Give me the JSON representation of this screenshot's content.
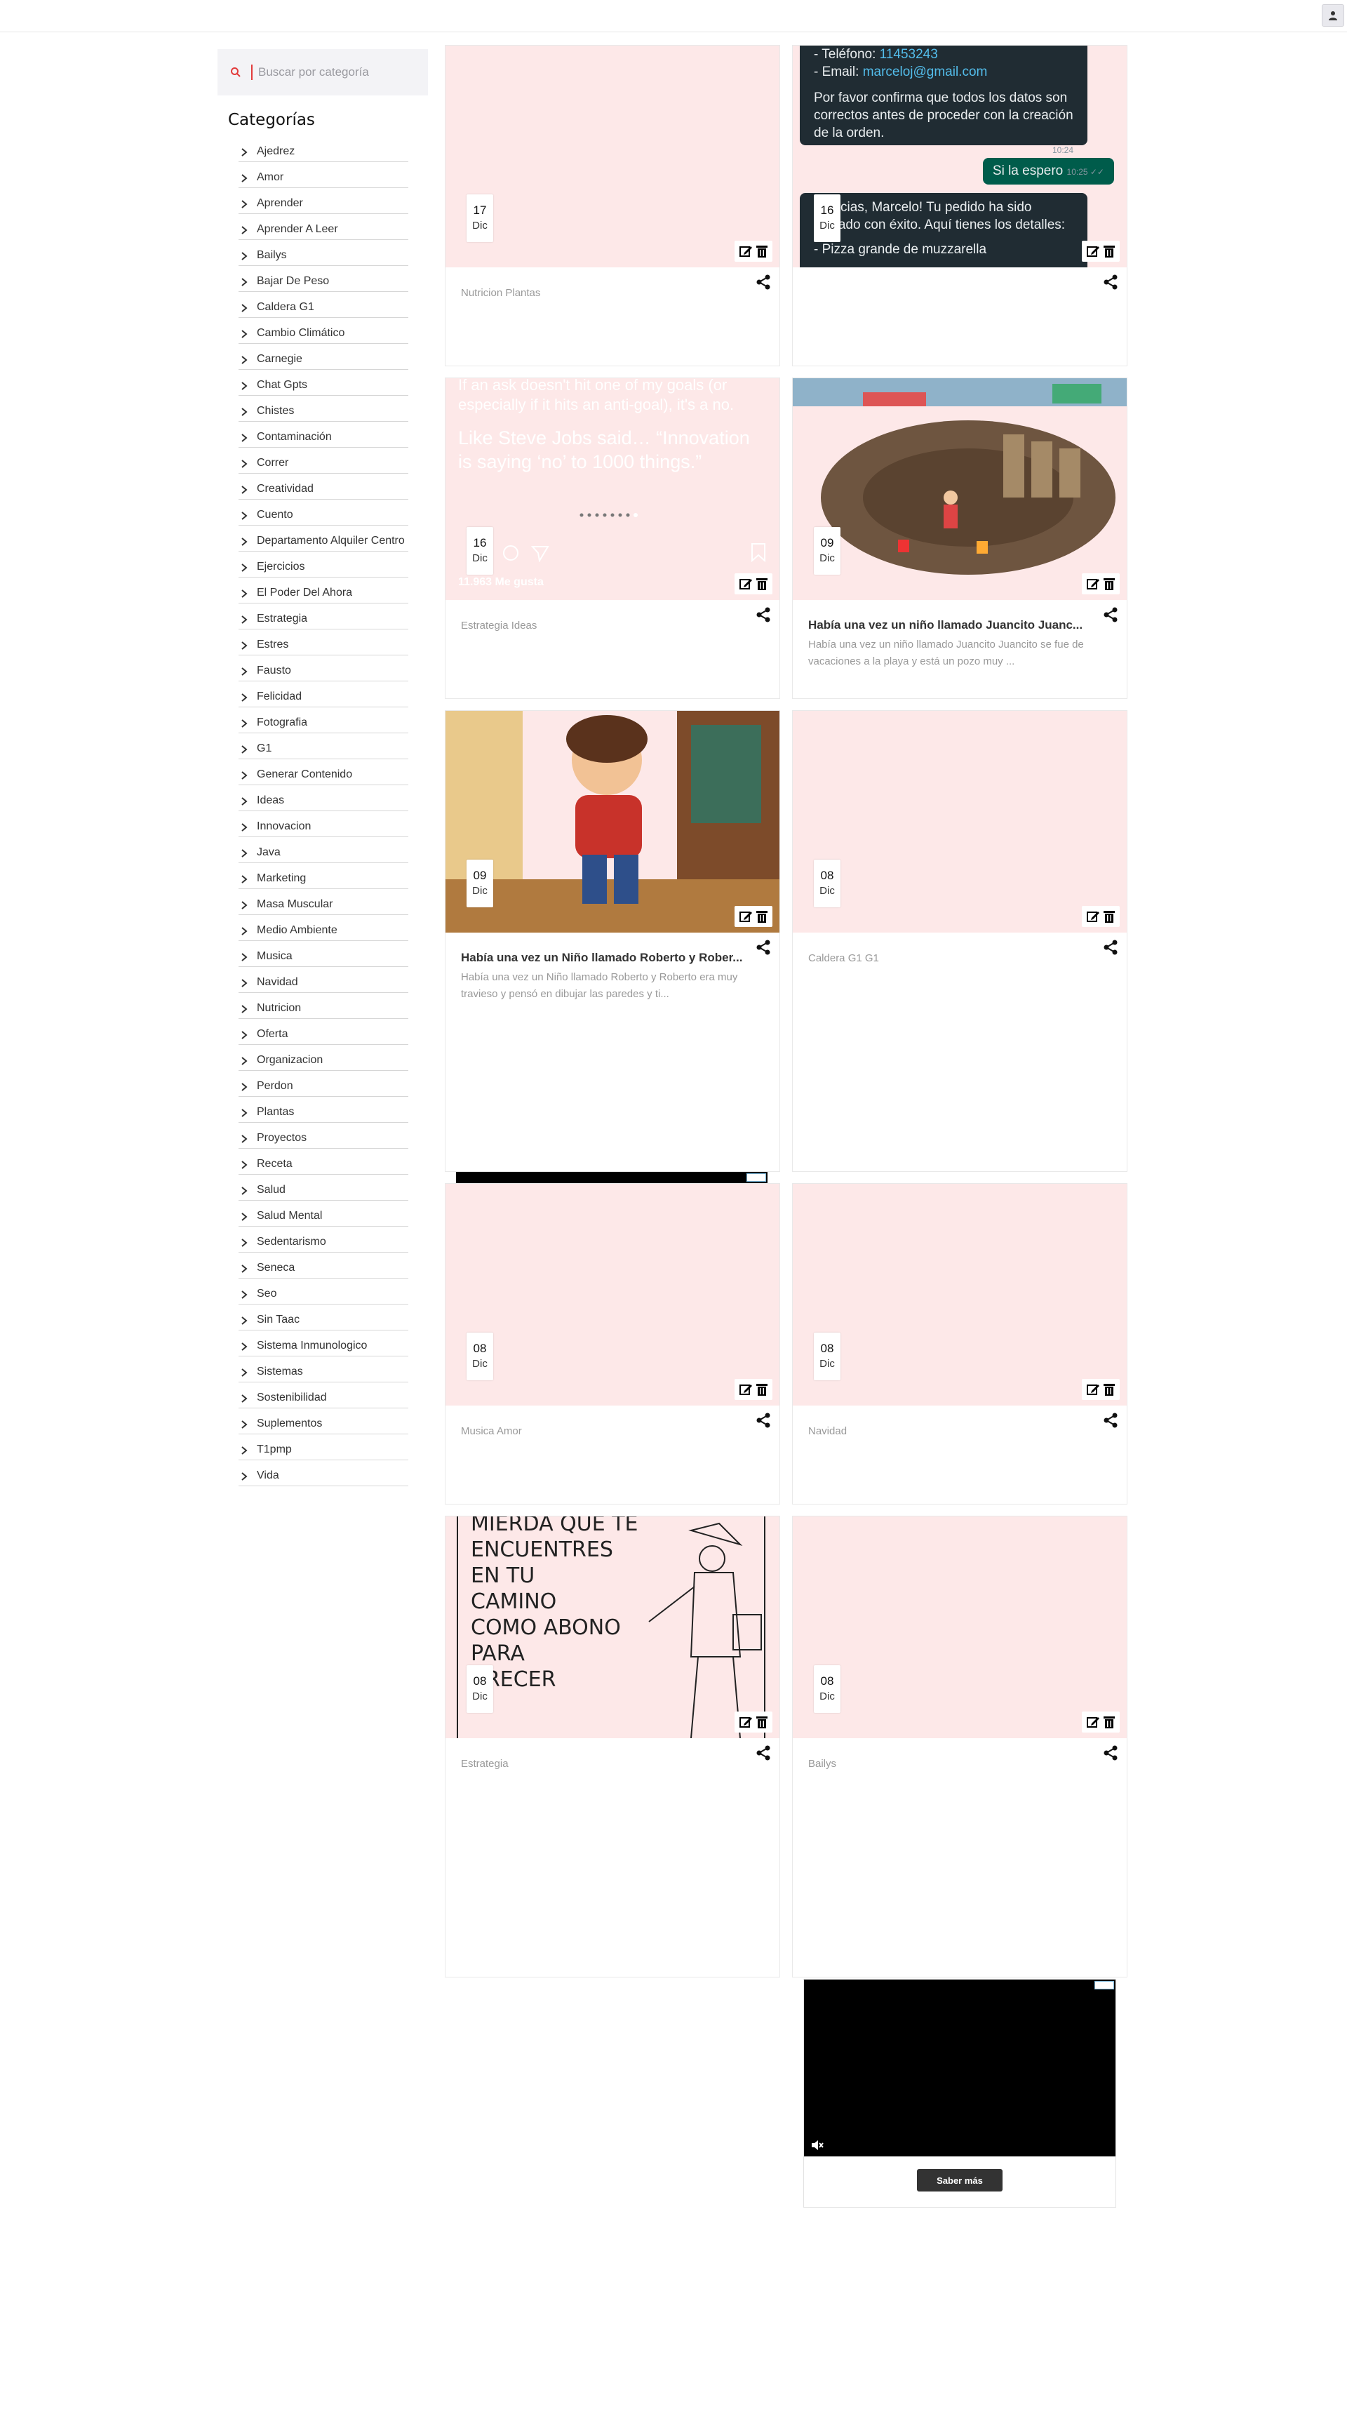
{
  "search": {
    "placeholder": "Buscar por categoría"
  },
  "sidebar": {
    "title": "Categorías",
    "categories": [
      "Ajedrez",
      "Amor",
      "Aprender",
      "Aprender A Leer",
      "Bailys",
      "Bajar De Peso",
      "Caldera G1",
      "Cambio Climático",
      "Carnegie",
      "Chat Gpts",
      "Chistes",
      "Contaminación",
      "Correr",
      "Creatividad",
      "Cuento",
      "Departamento Alquiler Centro",
      "Ejercicios",
      "El Poder Del Ahora",
      "Estrategia",
      "Estres",
      "Fausto",
      "Felicidad",
      "Fotografia",
      "G1",
      "Generar Contenido",
      "Ideas",
      "Innovacion",
      "Java",
      "Marketing",
      "Masa Muscular",
      "Medio Ambiente",
      "Musica",
      "Navidad",
      "Nutricion",
      "Oferta",
      "Organizacion",
      "Perdon",
      "Plantas",
      "Proyectos",
      "Receta",
      "Salud",
      "Salud Mental",
      "Sedentarismo",
      "Seneca",
      "Seo",
      "Sin Taac",
      "Sistema Inmunologico",
      "Sistemas",
      "Sostenibilidad",
      "Suplementos",
      "T1pmp",
      "Vida"
    ]
  },
  "cards": [
    {
      "day": "17",
      "month": "Dic",
      "category": "Nutricion Plantas"
    },
    {
      "day": "16",
      "month": "Dic",
      "category": "",
      "chat": {
        "phone_label": "- Teléfono: ",
        "phone": "11453243",
        "email_label": "- Email: ",
        "email": "marceloj@gmail.com",
        "confirm": "Por favor confirma que todos los datos son correctos antes de proceder con la creación de la orden.",
        "time1": "10:24",
        "reply": "Si la espero",
        "time2": "10:25 ✓✓",
        "answer": "¡Gracias, Marcelo! Tu pedido ha sido enviado con éxito. Aquí tienes los detalles:",
        "item": "- Pizza grande de muzzarella"
      }
    },
    {
      "day": "16",
      "month": "Dic",
      "category": "Estrategia Ideas",
      "quote1": "If an ask doesn't hit one of my goals (or especially if it hits an anti-goal), it's a no.",
      "quote2": "Like Steve Jobs said… “Innovation is saying ‘no’ to 1000 things.”",
      "likes": "11.963 Me gusta"
    },
    {
      "day": "09",
      "month": "Dic",
      "title": "Había una vez un niño llamado  Juancito Juanc...",
      "desc": "Había una vez un niño llamado  Juancito Juancito se fue de vacaciones a la playa y está un pozo muy ..."
    },
    {
      "day": "09",
      "month": "Dic",
      "title": "Había una vez un Niño llamado Roberto y Rober...",
      "desc": "Había una vez un Niño llamado Roberto y Roberto era muy travieso y pensó en dibujar las paredes y ti..."
    },
    {
      "day": "08",
      "month": "Dic",
      "category": "Caldera G1 G1"
    },
    {
      "day": "08",
      "month": "Dic",
      "category": "Musica Amor"
    },
    {
      "day": "08",
      "month": "Dic",
      "category": "Navidad"
    },
    {
      "day": "08",
      "month": "Dic",
      "category": "Estrategia",
      "poster": [
        "MIERDA QUE TE",
        "ENCUENTRES",
        "EN TU",
        "CAMINO",
        "COMO ABONO",
        "PARA",
        "CRECER"
      ]
    },
    {
      "day": "08",
      "month": "Dic",
      "category": "Bailys"
    }
  ],
  "ad": {
    "cta": "Saber más"
  },
  "colors": {
    "placeholder_bg": "#fde8e8",
    "accent": "#e23b3b"
  }
}
